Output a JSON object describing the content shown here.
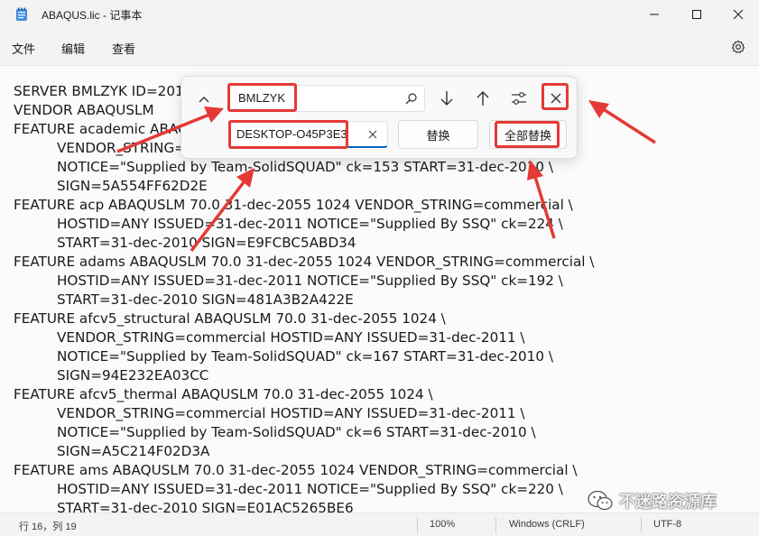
{
  "window": {
    "title": "ABAQUS.lic - 记事本",
    "minimize_icon": "minimize-icon",
    "maximize_icon": "maximize-icon",
    "close_icon": "close-icon"
  },
  "menu": {
    "items": [
      {
        "label": "文件"
      },
      {
        "label": "编辑"
      },
      {
        "label": "查看"
      }
    ],
    "settings_icon": "gear-icon"
  },
  "editor": {
    "lines": [
      {
        "text": "SERVER BMLZYK ID=201",
        "indent": false
      },
      {
        "text": "VENDOR ABAQUSLM",
        "indent": false
      },
      {
        "text": "FEATURE academic ABAQ",
        "indent": false
      },
      {
        "text": "VENDOR_STRING=",
        "indent": true
      },
      {
        "text": "NOTICE=\"Supplied by Team-SolidSQUAD\" ck=153 START=31-dec-2010 \\",
        "indent": true
      },
      {
        "text": "SIGN=5A554FF62D2E",
        "indent": true
      },
      {
        "text": "FEATURE acp ABAQUSLM 70.0 31-dec-2055 1024 VENDOR_STRING=commercial \\",
        "indent": false
      },
      {
        "text": "HOSTID=ANY ISSUED=31-dec-2011 NOTICE=\"Supplied By SSQ\" ck=224 \\",
        "indent": true
      },
      {
        "text": "START=31-dec-2010 SIGN=E9FCBC5ABD34",
        "indent": true
      },
      {
        "text": "FEATURE adams ABAQUSLM 70.0 31-dec-2055 1024 VENDOR_STRING=commercial \\",
        "indent": false
      },
      {
        "text": "HOSTID=ANY ISSUED=31-dec-2011 NOTICE=\"Supplied By SSQ\" ck=192 \\",
        "indent": true
      },
      {
        "text": "START=31-dec-2010 SIGN=481A3B2A422E",
        "indent": true
      },
      {
        "text": "FEATURE afcv5_structural ABAQUSLM 70.0 31-dec-2055 1024 \\",
        "indent": false
      },
      {
        "text": "VENDOR_STRING=commercial HOSTID=ANY ISSUED=31-dec-2011 \\",
        "indent": true
      },
      {
        "text": "NOTICE=\"Supplied by Team-SolidSQUAD\" ck=167 START=31-dec-2010 \\",
        "indent": true
      },
      {
        "text": "SIGN=94E232EA03CC",
        "indent": true
      },
      {
        "text": "FEATURE afcv5_thermal ABAQUSLM 70.0 31-dec-2055 1024 \\",
        "indent": false
      },
      {
        "text": "VENDOR_STRING=commercial HOSTID=ANY ISSUED=31-dec-2011 \\",
        "indent": true
      },
      {
        "text": "NOTICE=\"Supplied by Team-SolidSQUAD\" ck=6 START=31-dec-2010 \\",
        "indent": true
      },
      {
        "text": "SIGN=A5C214F02D3A",
        "indent": true
      },
      {
        "text": "FEATURE ams ABAQUSLM 70.0 31-dec-2055 1024 VENDOR_STRING=commercial \\",
        "indent": false
      },
      {
        "text": "HOSTID=ANY ISSUED=31-dec-2011 NOTICE=\"Supplied By SSQ\" ck=220 \\",
        "indent": true
      },
      {
        "text": "START=31-dec-2010 SIGN=E01AC5265BE6",
        "indent": true
      }
    ]
  },
  "find_replace": {
    "find_value": "BMLZYK",
    "replace_value": "DESKTOP-O45P3E3",
    "replace_button": "替换",
    "replace_all_button": "全部替换",
    "icons": {
      "collapse": "chevron-up-icon",
      "search": "search-icon",
      "next": "arrow-down-icon",
      "previous": "arrow-up-icon",
      "options": "options-icon",
      "close": "close-icon",
      "clear": "clear-icon"
    }
  },
  "status": {
    "position": "行 16，列 19",
    "zoom": "100%",
    "line_ending": "Windows (CRLF)",
    "encoding": "UTF-8"
  },
  "watermark": {
    "text": "不迷路资源库"
  },
  "colors": {
    "highlight": "#e53935",
    "accent": "#0067c0"
  }
}
